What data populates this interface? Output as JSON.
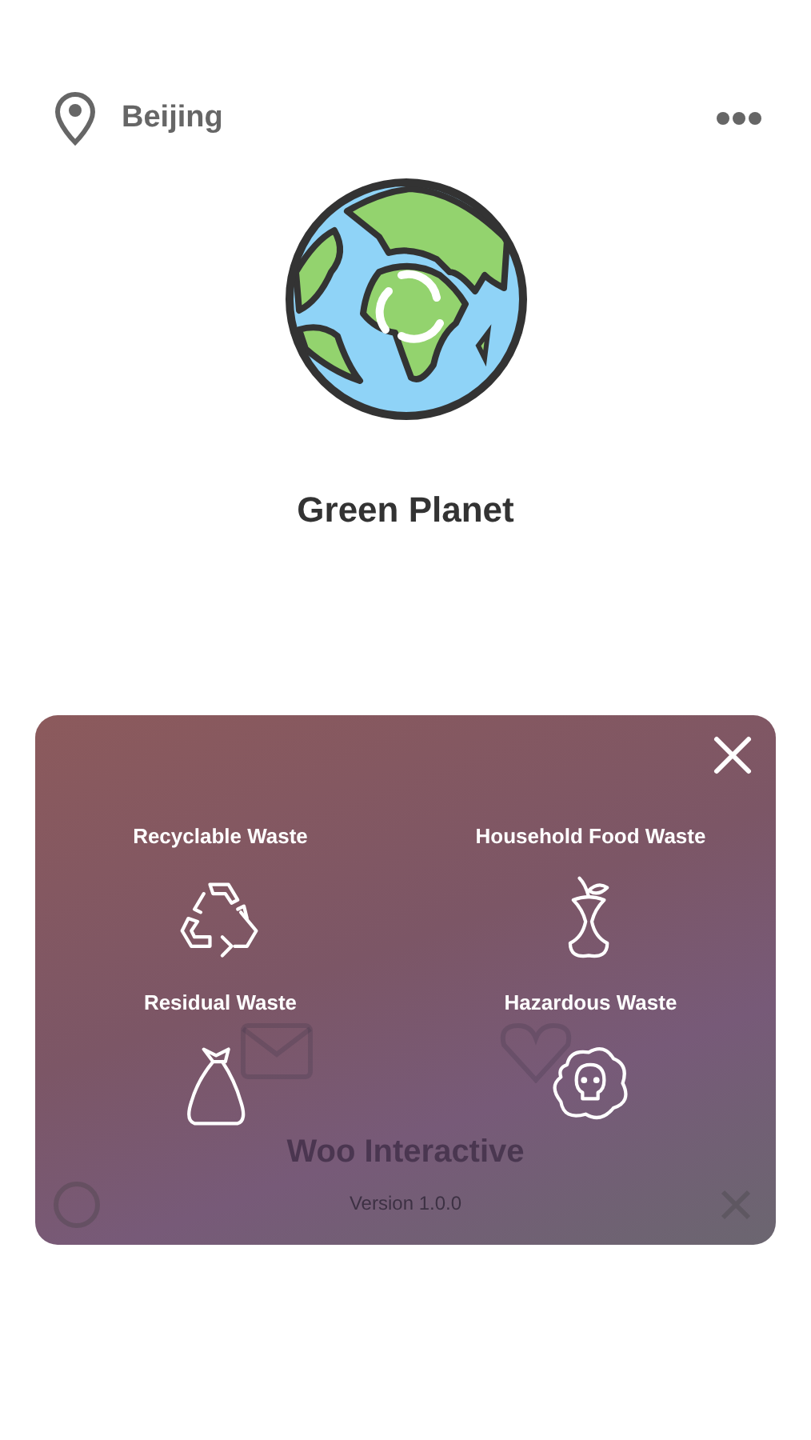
{
  "header": {
    "location": "Beijing"
  },
  "app": {
    "title": "Green Planet"
  },
  "background_card": {
    "title": "Woo Interactive",
    "version": "Version 1.0.0"
  },
  "panel": {
    "categories": [
      {
        "label": "Recyclable Waste",
        "kind": "recycle"
      },
      {
        "label": "Household Food Waste",
        "kind": "food"
      },
      {
        "label": "Residual Waste",
        "kind": "bag"
      },
      {
        "label": "Hazardous Waste",
        "kind": "hazard"
      }
    ]
  }
}
